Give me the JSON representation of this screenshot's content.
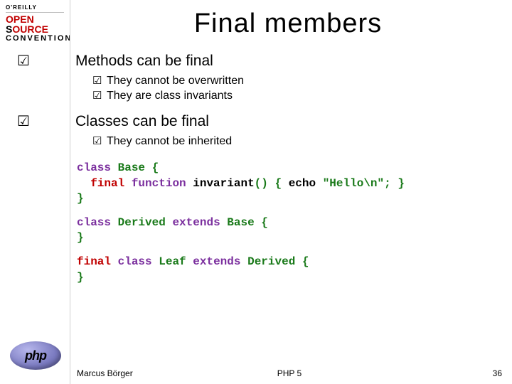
{
  "logo": {
    "oreilly_top": "O'REILLY",
    "oreilly_open": "OPEN",
    "oreilly_source": "SOURCE",
    "oreilly_conv": "CONVENTION",
    "php": "php"
  },
  "title": "Final members",
  "points": [
    {
      "text": "Methods can be final",
      "subs": [
        "They cannot be overwritten",
        "They are class invariants"
      ]
    },
    {
      "text": "Classes can be final",
      "subs": [
        "They cannot be inherited"
      ]
    }
  ],
  "code": {
    "b1": {
      "l1a": "class",
      "l1b": "Base",
      "l1c": "{",
      "l2a": "final",
      "l2b": "function",
      "l2c": "invariant",
      "l2d": "() {",
      "l2e": "echo",
      "l2f": "\"Hello\\n\"",
      "l2g": "; }",
      "l3a": "}"
    },
    "b2": {
      "l1a": "class",
      "l1b": "Derived",
      "l1c": "extends",
      "l1d": "Base",
      "l1e": "{",
      "l2a": "}"
    },
    "b3": {
      "l1a": "final",
      "l1b": "class",
      "l1c": "Leaf",
      "l1d": "extends",
      "l1e": "Derived",
      "l1f": "{",
      "l2a": "}"
    }
  },
  "footer": {
    "author": "Marcus Börger",
    "center": "PHP 5",
    "page": "36"
  },
  "glyph": {
    "check": "☑"
  }
}
